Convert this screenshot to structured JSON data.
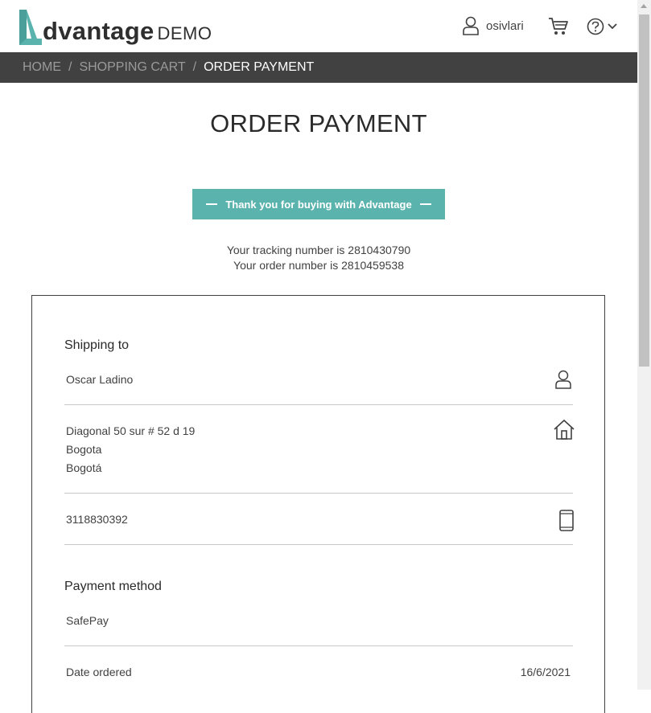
{
  "header": {
    "logo_text": "dvantage",
    "logo_demo": "DEMO",
    "username": "osivlari",
    "colors": {
      "accent": "#5bb3ae",
      "dark": "#414141"
    }
  },
  "breadcrumb": {
    "items": [
      "HOME",
      "SHOPPING CART",
      "ORDER PAYMENT"
    ],
    "separator": "/"
  },
  "page": {
    "title": "ORDER PAYMENT",
    "thank_you": "Thank you for buying with Advantage",
    "tracking_line": "Your tracking number is 2810430790",
    "order_line": "Your order number is 2810459538"
  },
  "shipping": {
    "title": "Shipping to",
    "name": "Oscar Ladino",
    "address_line1": "Diagonal 50 sur # 52 d 19",
    "address_line2": "Bogota",
    "address_line3": "Bogotá",
    "phone": "3118830392"
  },
  "payment": {
    "title": "Payment method",
    "method": "SafePay",
    "date_label": "Date ordered",
    "date_value": "16/6/2021"
  },
  "icons": [
    "user-icon",
    "cart-icon",
    "help-icon",
    "chevron-down-icon",
    "home-icon",
    "phone-icon"
  ]
}
